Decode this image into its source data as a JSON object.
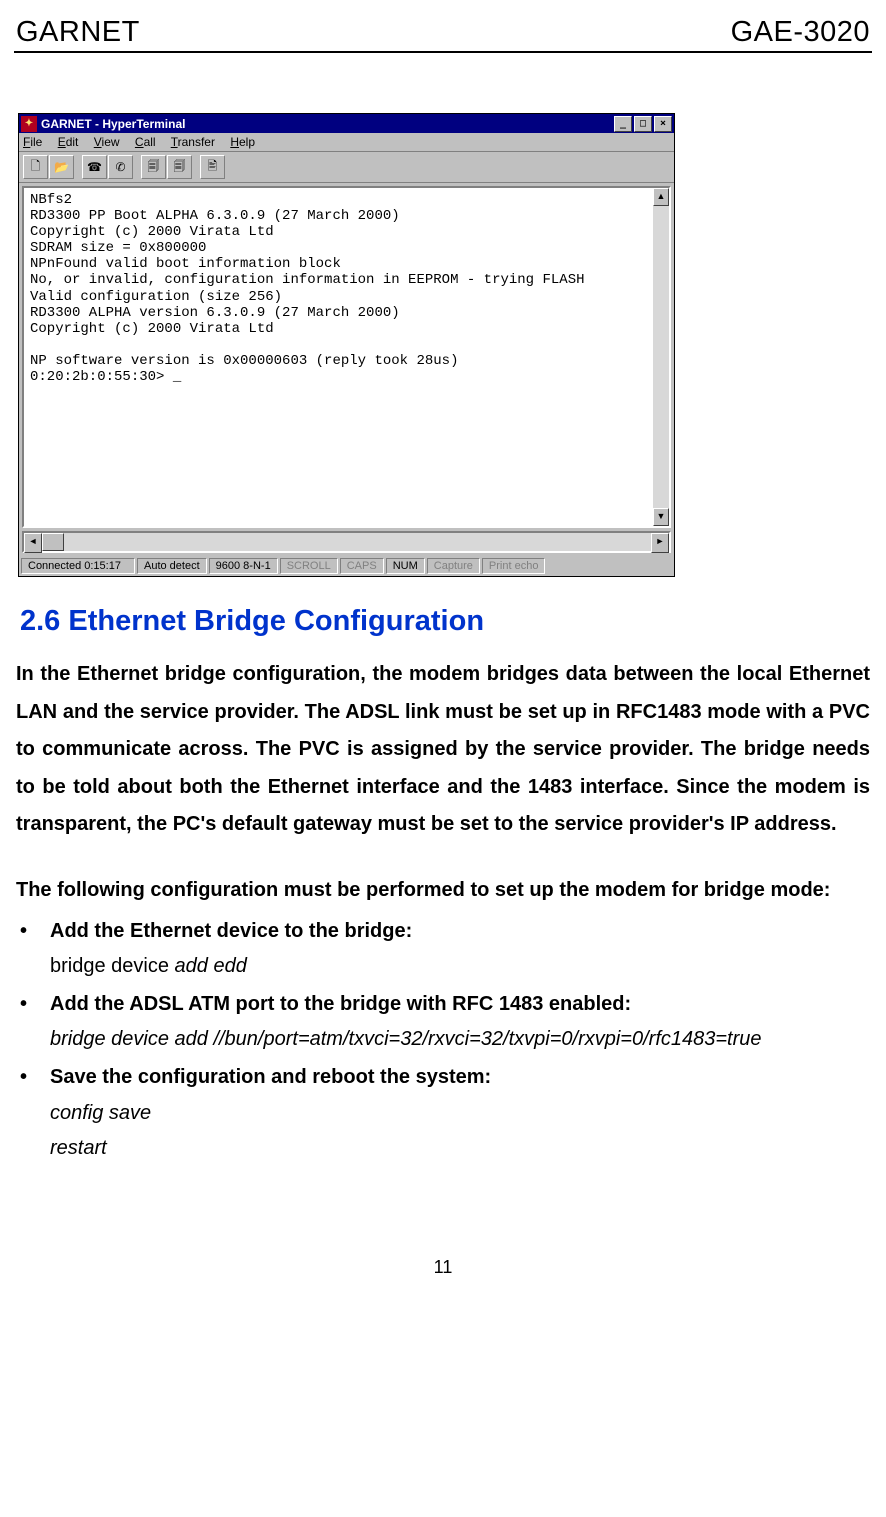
{
  "header": {
    "left": "GARNET",
    "right": "GAE-3020"
  },
  "window": {
    "title": "GARNET - HyperTerminal",
    "menus": [
      "File",
      "Edit",
      "View",
      "Call",
      "Transfer",
      "Help"
    ],
    "toolbar_icons": [
      "new-doc-icon",
      "open-icon",
      "connect-icon",
      "disconnect-icon",
      "send-icon",
      "receive-icon",
      "properties-icon"
    ],
    "terminal_text": "NBfs2\nRD3300 PP Boot ALPHA 6.3.0.9 (27 March 2000)\nCopyright (c) 2000 Virata Ltd\nSDRAM size = 0x800000\nNPnFound valid boot information block\nNo, or invalid, configuration information in EEPROM - trying FLASH\nValid configuration (size 256)\nRD3300 ALPHA version 6.3.0.9 (27 March 2000)\nCopyright (c) 2000 Virata Ltd\n\nNP software version is 0x00000603 (reply took 28us)\n0:20:2b:0:55:30> _",
    "status": {
      "connected": "Connected 0:15:17",
      "detect": "Auto detect",
      "baud": "9600 8-N-1",
      "scroll": "SCROLL",
      "caps": "CAPS",
      "num": "NUM",
      "capture": "Capture",
      "printecho": "Print echo"
    }
  },
  "section": {
    "heading": "2.6 Ethernet Bridge Configuration",
    "para1": "In the Ethernet bridge configuration, the modem bridges data between the local Ethernet LAN and the service provider. The ADSL link must be set up in RFC1483 mode with a PVC to communicate across. The PVC is assigned by the service provider. The bridge needs to be told about both the Ethernet interface and the 1483 interface. Since the modem is transparent, the PC's default gateway must be set to the service provider's IP address.",
    "para2": "The following configuration must be performed to set up the modem for bridge mode:",
    "bullets": [
      {
        "head": "Add the Ethernet device to the bridge:",
        "cmd_prefix": "bridge device ",
        "cmd_italic": "add edd"
      },
      {
        "head": "Add the ADSL ATM port to the bridge with RFC 1483 enabled:",
        "cmd_full": "bridge device add //bun/port=atm/txvci=32/rxvci=32/txvpi=0/rxvpi=0/rfc1483=true"
      },
      {
        "head": "Save the configuration and reboot the system:",
        "cmd1": "config save",
        "cmd2": " restart"
      }
    ]
  },
  "page_number": "11"
}
